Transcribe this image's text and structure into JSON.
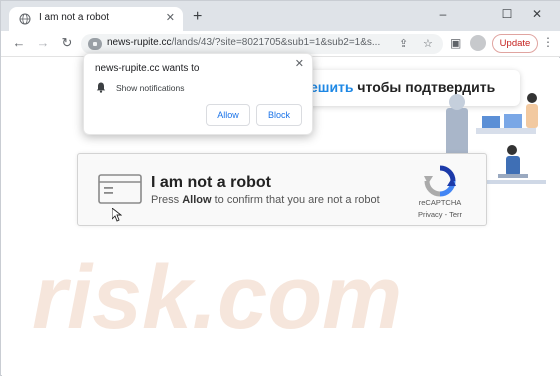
{
  "browser": {
    "tab_title": "I am not a robot",
    "tab_close": "✕",
    "new_tab": "+",
    "url_host": "news-rupite.cc",
    "url_path": "/lands/43/?site=8021705&sub1=1&sub2=1&s...",
    "update_label": "Update",
    "icons": [
      "back-icon",
      "forward-icon",
      "reload-icon",
      "lock-icon",
      "share-icon",
      "star-icon",
      "sidepanel-icon",
      "profile-icon",
      "menu-icon"
    ]
  },
  "notification_prompt": {
    "title": "news-rupite.cc wants to",
    "permission": "Show notifications",
    "allow_label": "Allow",
    "block_label": "Block",
    "close": "✕"
  },
  "page": {
    "banner_blue": "ешить",
    "banner_rest": " чтобы подтвердить",
    "captcha_title": "I am not a robot",
    "captcha_pre": "Press ",
    "captcha_bold": "Allow",
    "captcha_post": " to confirm that you are not a robot",
    "recaptcha_label": "reCAPTCHA",
    "recaptcha_links": "Privacy - Terr",
    "watermark": "risk.com"
  },
  "colors": {
    "accent": "#1a73e8",
    "update_red": "#c5221f",
    "banner_blue": "#1e88e5"
  }
}
